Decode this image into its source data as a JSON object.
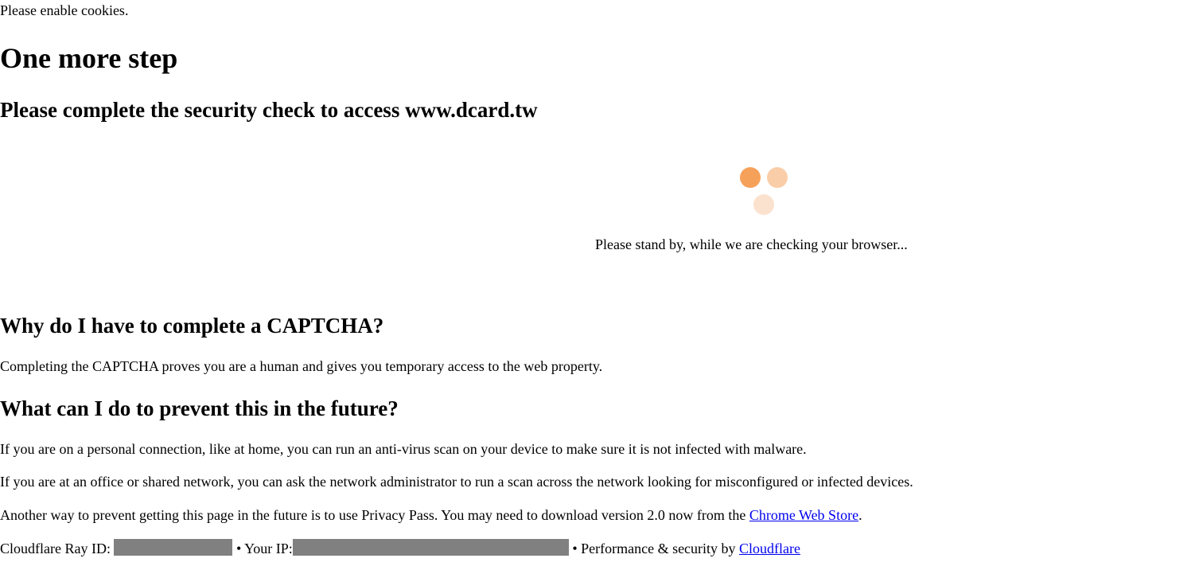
{
  "cookie_notice": "Please enable cookies.",
  "heading": "One more step",
  "subheading_prefix": "Please complete the security check to access ",
  "subheading_domain": "www.dcard.tw",
  "loader": {
    "dot_colors": [
      "#f6a15a",
      "#f9cda7",
      "#fbe2cf"
    ]
  },
  "standby_text": "Please stand by, while we are checking your browser...",
  "why_heading": "Why do I have to complete a CAPTCHA?",
  "why_text": "Completing the CAPTCHA proves you are a human and gives you temporary access to the web property.",
  "prevent_heading": "What can I do to prevent this in the future?",
  "prevent_text_1": "If you are on a personal connection, like at home, you can run an anti-virus scan on your device to make sure it is not infected with malware.",
  "prevent_text_2": "If you are at an office or shared network, you can ask the network administrator to run a scan across the network looking for misconfigured or infected devices.",
  "prevent_text_3_before": "Another way to prevent getting this page in the future is to use Privacy Pass. You may need to download version 2.0 now from the ",
  "prevent_text_3_link": "Chrome Web Store",
  "prevent_text_3_after": ".",
  "footer": {
    "ray_label": "Cloudflare Ray ID: ",
    "ip_label": " • Your IP:",
    "perf_label": " • Performance & security by ",
    "cloudflare_link": "Cloudflare"
  },
  "colors": {
    "link": "#0000ee",
    "redaction": "#808080"
  }
}
